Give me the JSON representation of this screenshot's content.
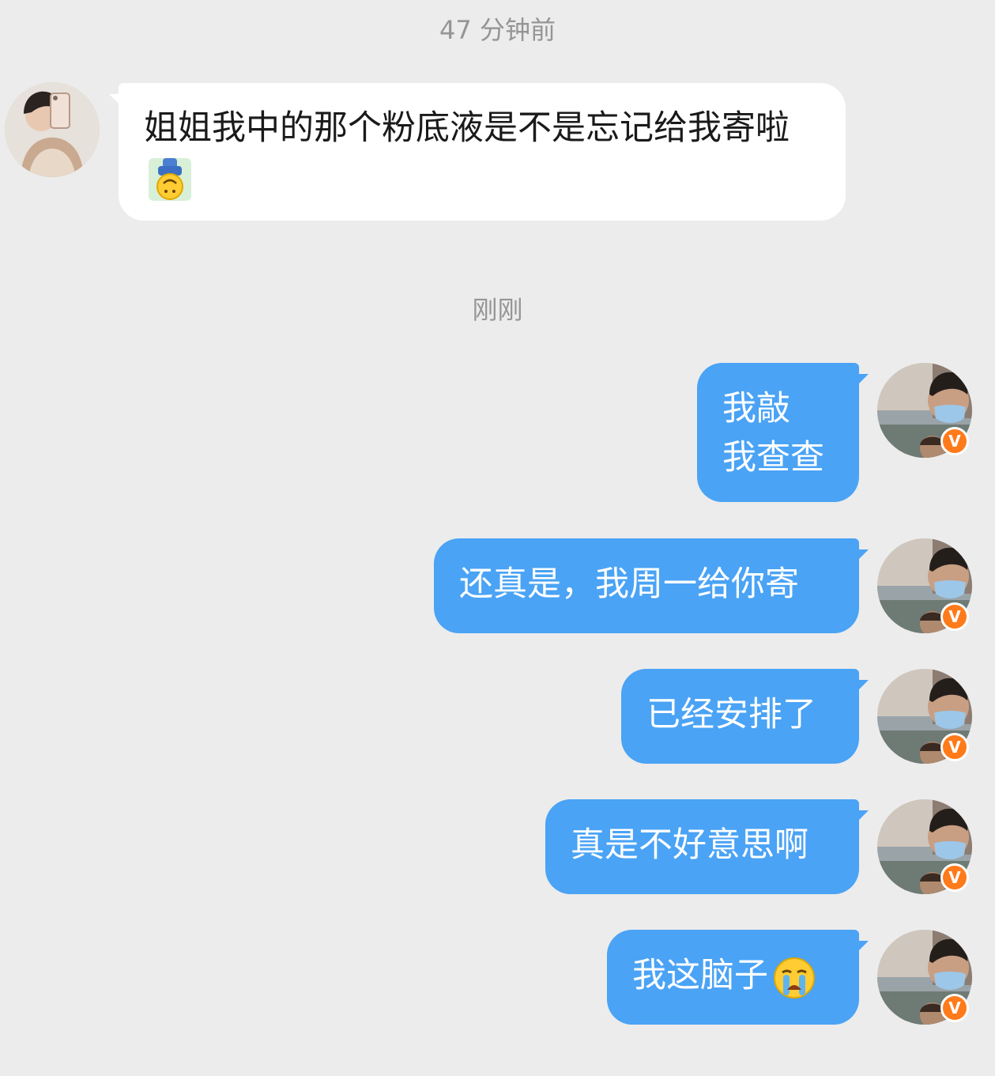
{
  "timestamps": {
    "first": "47 分钟前",
    "second": "刚刚"
  },
  "incoming_message": {
    "text": "姐姐我中的那个粉底液是不是忘记给我寄啦",
    "emoji": "upside-down-face-emoji"
  },
  "outgoing_messages": [
    {
      "line1": "我敲",
      "line2": "我查查"
    },
    {
      "text": "还真是，我周一给你寄"
    },
    {
      "text": "已经安排了"
    },
    {
      "text": "真是不好意思啊"
    },
    {
      "text": "我这脑子",
      "emoji": "loudly-crying-face-emoji"
    }
  ],
  "verified_badge": "V",
  "colors": {
    "background": "#ececec",
    "incoming_bubble": "#ffffff",
    "outgoing_bubble": "#4aa3f5",
    "timestamp_text": "#959595",
    "badge": "#ff7a1a"
  }
}
